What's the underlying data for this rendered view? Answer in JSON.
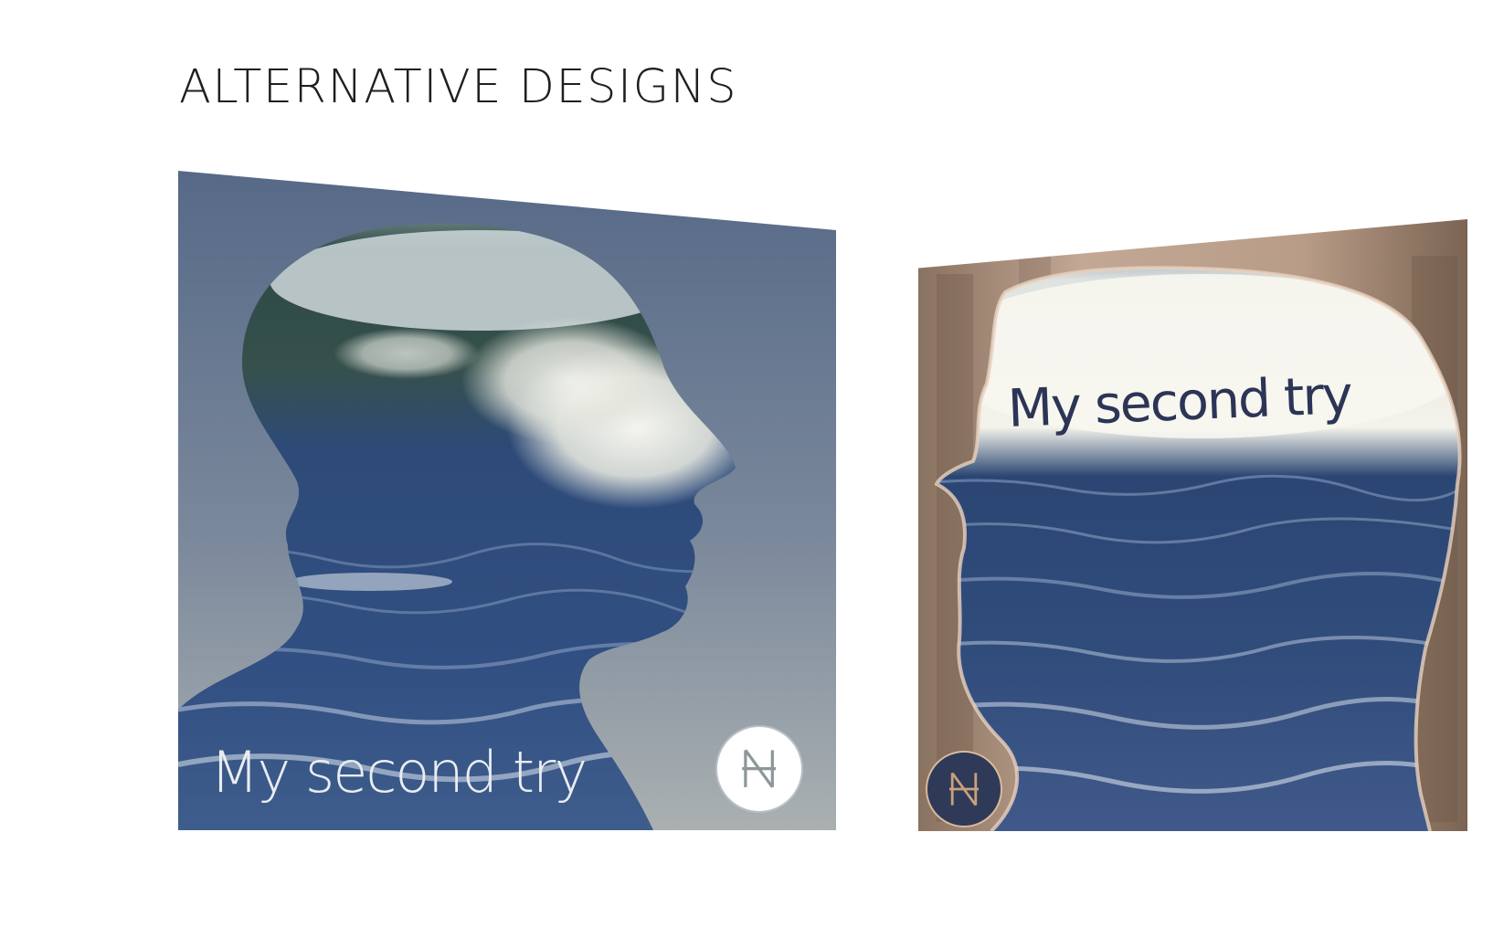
{
  "heading": "ALTERNATIVE DESIGNS",
  "designs": [
    {
      "title": "My second try",
      "logo_letters": "NH",
      "background": "blue-grey gradient",
      "logo_style": "white circle, grey monogram"
    },
    {
      "title": "My second try",
      "logo_letters": "NH",
      "background": "warm beige blurred forest",
      "logo_style": "navy circle, copper monogram"
    }
  ],
  "colors": {
    "heading": "#1f1f1f",
    "left_sky_top": "#5a6c8b",
    "left_sky_bottom": "#a6aeb1",
    "right_bg": "#b69a86",
    "ocean": "#2f4d7a",
    "foam": "#f3f4ee",
    "right_title": "#2c3556",
    "logo_navy": "#2e3a57",
    "logo_copper": "#c9a07c"
  }
}
